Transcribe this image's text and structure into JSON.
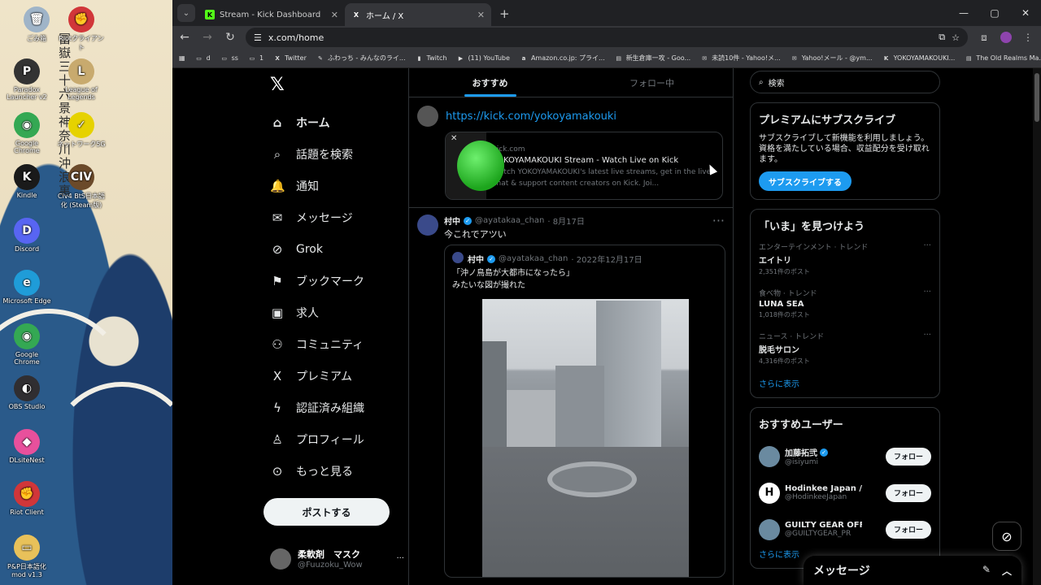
{
  "desktop": {
    "calligraphy": "冨嶽三十六景 神奈川沖浪裏",
    "icons": [
      {
        "label": "ごみ箱",
        "glyph": "🗑",
        "color": "#9fb4c8"
      },
      {
        "label": "Riotクライアント",
        "glyph": "✊",
        "color": "#d13639"
      },
      {
        "label": "Paradox Launcher v2",
        "glyph": "P",
        "color": "#333333"
      },
      {
        "label": "League of Legends",
        "glyph": "L",
        "color": "#c8aa6e"
      },
      {
        "label": "Google Chrome",
        "glyph": "◉",
        "color": "#34a853"
      },
      {
        "label": "ネットワーク5G",
        "glyph": "✓",
        "color": "#e6d200"
      },
      {
        "label": "Kindle",
        "glyph": "K",
        "color": "#1a1a1a"
      },
      {
        "label": "Civ4 BtS日本語化 (Steam版)",
        "glyph": "CIV",
        "color": "#6b4a2a"
      },
      {
        "label": "Discord",
        "glyph": "D",
        "color": "#5865f2"
      },
      {
        "label": "Microsoft Edge",
        "glyph": "e",
        "color": "#1f9cd8"
      },
      {
        "label": "Google Chrome",
        "glyph": "◉",
        "color": "#34a853"
      },
      {
        "label": "OBS Studio",
        "glyph": "◐",
        "color": "#302e31"
      },
      {
        "label": "DLsiteNest",
        "glyph": "◆",
        "color": "#e8509c"
      },
      {
        "label": "Riot Client",
        "glyph": "✊",
        "color": "#d13639"
      },
      {
        "label": "P&P日本語化mod v1.3",
        "glyph": "▭",
        "color": "#e8c15a"
      }
    ]
  },
  "browser": {
    "tabs": [
      {
        "title": "Stream - Kick Dashboard",
        "favicon": "K",
        "favcolor": "#53fc18"
      },
      {
        "title": "ホーム / X",
        "favicon": "X",
        "favcolor": "#ffffff"
      }
    ],
    "url": "x.com/home",
    "bookmarks": [
      {
        "label": "d",
        "icon": "▭"
      },
      {
        "label": "ss",
        "icon": "▭"
      },
      {
        "label": "1",
        "icon": "▭"
      },
      {
        "label": "Twitter",
        "icon": "X"
      },
      {
        "label": "ふわっち - みんなのライ...",
        "icon": "✎"
      },
      {
        "label": "Twitch",
        "icon": "▮"
      },
      {
        "label": "(11) YouTube",
        "icon": "▶"
      },
      {
        "label": "Amazon.co.jp: プライ...",
        "icon": "a"
      },
      {
        "label": "新生倉庫一攻 - Goo...",
        "icon": "▤"
      },
      {
        "label": "未読10件 - Yahoo!メ...",
        "icon": "✉"
      },
      {
        "label": "Yahoo!メール - @ym...",
        "icon": "✉"
      },
      {
        "label": "YOKOYAMAKOUKI...",
        "icon": "K"
      },
      {
        "label": "The Old Realms Ma...",
        "icon": "▤"
      }
    ]
  },
  "x": {
    "nav": [
      {
        "label": "ホーム",
        "icon": "⌂",
        "active": true
      },
      {
        "label": "話題を検索",
        "icon": "⌕"
      },
      {
        "label": "通知",
        "icon": "🔔"
      },
      {
        "label": "メッセージ",
        "icon": "✉"
      },
      {
        "label": "Grok",
        "icon": "⊘"
      },
      {
        "label": "ブックマーク",
        "icon": "⚑"
      },
      {
        "label": "求人",
        "icon": "▣"
      },
      {
        "label": "コミュニティ",
        "icon": "⚇"
      },
      {
        "label": "プレミアム",
        "icon": "X"
      },
      {
        "label": "認証済み組織",
        "icon": "ϟ"
      },
      {
        "label": "プロフィール",
        "icon": "♙"
      },
      {
        "label": "もっと見る",
        "icon": "⊙"
      }
    ],
    "post_button": "ポストする",
    "me": {
      "name": "柔軟剤　マスク",
      "handle": "@Fuuzoku_Wow"
    },
    "feed_tabs": [
      "おすすめ",
      "フォロー中"
    ],
    "compose": {
      "link": "https://kick.com/yokoyamakouki",
      "card_domain": "kick.com",
      "card_title": "YOKOYAMAKOUKI Stream - Watch Live on Kick",
      "card_desc": "Watch YOKOYAMAKOUKI's latest live streams, get in the live chat & support content creators on Kick. Joi..."
    },
    "tweet": {
      "name": "村中",
      "handle": "@ayatakaa_chan",
      "date": "· 8月17日",
      "text": "今これでアツい",
      "quote": {
        "name": "村中",
        "handle": "@ayatakaa_chan",
        "date": "· 2022年12月17日",
        "line1": "「沖ノ鳥島が大都市になったら」",
        "line2": "みたいな図が撮れた"
      }
    },
    "search_placeholder": "検索",
    "premium": {
      "title": "プレミアムにサブスクライブ",
      "body": "サブスクライブして新機能を利用しましょう。資格を満たしている場合、収益配分を受け取れます。",
      "button": "サブスクライブする"
    },
    "trends": {
      "title": "「いま」を見つけよう",
      "items": [
        {
          "category": "エンターテインメント · トレンド",
          "name": "エイトリ",
          "count": "2,351件のポスト"
        },
        {
          "category": "食べ物 · トレンド",
          "name": "LUNA SEA",
          "count": "1,018件のポスト"
        },
        {
          "category": "ニュース · トレンド",
          "name": "脱毛サロン",
          "count": "4,316件のポスト"
        }
      ],
      "more": "さらに表示"
    },
    "who_to_follow": {
      "title": "おすすめユーザー",
      "users": [
        {
          "name": "加藤拓弐",
          "handle": "@isiyumi",
          "badge": "blue",
          "initial": ""
        },
        {
          "name": "Hodinkee Japan / ...",
          "handle": "@HodinkeeJapan",
          "badge": "gold",
          "initial": "H"
        },
        {
          "name": "GUILTY GEAR OFFI...",
          "handle": "@GUILTYGEAR_PR",
          "badge": "blue",
          "initial": ""
        }
      ],
      "follow_label": "フォロー",
      "more": "さらに表示"
    },
    "messages_drawer": "メッセージ"
  }
}
